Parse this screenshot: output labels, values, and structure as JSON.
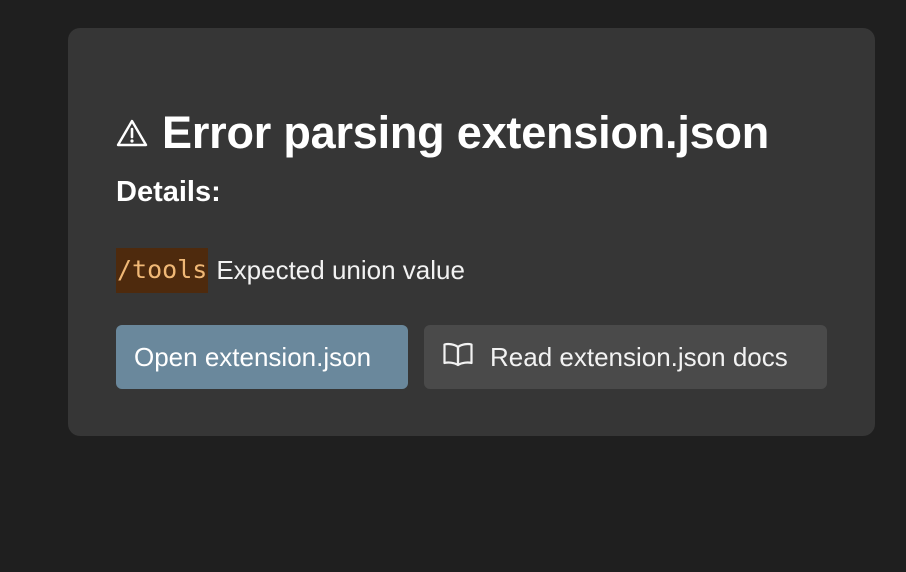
{
  "dialog": {
    "title": "Error parsing extension.json",
    "title_icon": "warning-triangle-icon",
    "details_heading": "Details:",
    "error": {
      "path": "/tools",
      "message": "Expected union value"
    },
    "actions": {
      "primary_label": "Open extension.json",
      "secondary_label": "Read extension.json docs",
      "secondary_icon": "open-book-icon"
    }
  },
  "colors": {
    "background": "#1f1f1f",
    "card": "#363636",
    "primary_button": "#6a889c",
    "secondary_button": "#4a4a4a",
    "code_text": "#f0b876",
    "code_background": "#4e2a0d"
  }
}
